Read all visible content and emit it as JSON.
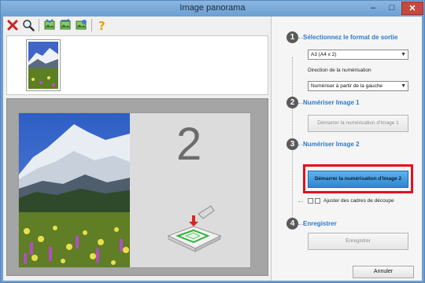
{
  "window": {
    "title": "Image panorama",
    "min_glyph": "–",
    "max_glyph": "□",
    "close_glyph": "✕"
  },
  "toolbar": {
    "items": [
      {
        "icon": "delete-icon"
      },
      {
        "icon": "zoom-icon"
      },
      {
        "icon": "image-arrange-icon"
      },
      {
        "icon": "image-swap-icon"
      },
      {
        "icon": "image-edit-icon"
      },
      {
        "icon": "help-icon"
      }
    ]
  },
  "preview": {
    "slot_number": "2"
  },
  "steps": {
    "step1": {
      "number": "1",
      "label": "Sélectionnez le format de sortie",
      "format_value": "A3 (A4 x 2)",
      "direction_label": "Direction de la numérisation",
      "direction_value": "Numériser à partir de la gauche"
    },
    "step2": {
      "number": "2",
      "label": "Numériser Image 1",
      "button": "Démarrer la numérisation d'Image 1"
    },
    "step3": {
      "number": "3",
      "label": "Numériser Image 2",
      "button": "Démarrer la numérisation d'Image 2",
      "adjust_label": "Ajuster des cadres de découpe"
    },
    "step4": {
      "number": "4",
      "label": "Enregistrer",
      "button": "Enregistrer"
    }
  },
  "footer": {
    "cancel": "Annuler"
  },
  "colors": {
    "accent": "#2e7ac9",
    "active_button": "#3a8fd6",
    "highlight": "#e2111a"
  }
}
